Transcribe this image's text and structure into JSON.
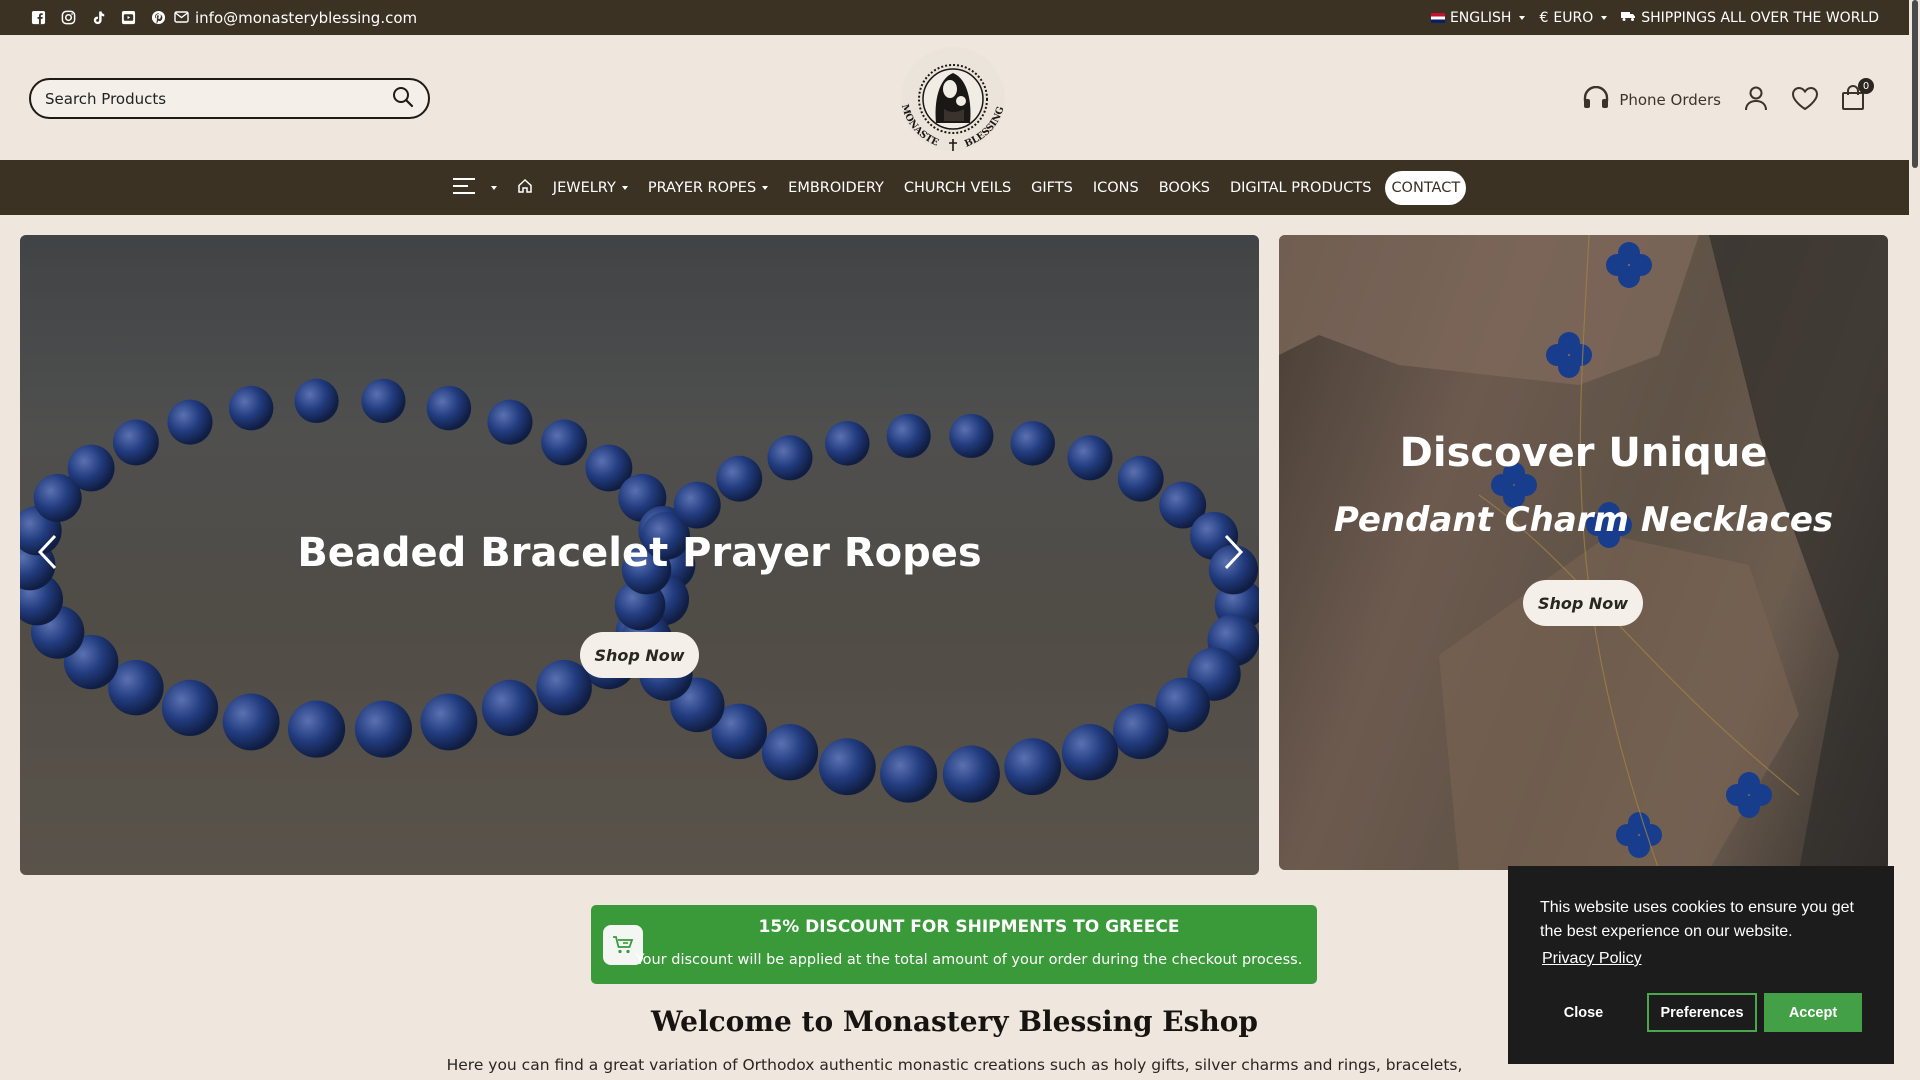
{
  "topbar": {
    "social_icons": [
      "facebook-icon",
      "instagram-icon",
      "tiktok-icon",
      "youtube-icon",
      "pinterest-icon"
    ],
    "email": "info@monasteryblessing.com",
    "language": "ENGLISH",
    "currency": "EURO",
    "currency_symbol": "€",
    "shipping_text": "SHIPPINGS ALL OVER THE WORLD"
  },
  "header": {
    "search_placeholder": "Search Products",
    "logo_text": "MONASTERY BLESSING",
    "phone_orders": "Phone Orders",
    "cart_count": "0"
  },
  "nav": {
    "items": [
      {
        "label": "JEWELRY",
        "dropdown": true
      },
      {
        "label": "PRAYER ROPES",
        "dropdown": true
      },
      {
        "label": "EMBROIDERY"
      },
      {
        "label": "CHURCH VEILS"
      },
      {
        "label": "GIFTS"
      },
      {
        "label": "ICONS"
      },
      {
        "label": "BOOKS"
      },
      {
        "label": "DIGITAL PRODUCTS"
      },
      {
        "label": "CONTACT",
        "active": true
      }
    ]
  },
  "hero": {
    "main_title": "Beaded Bracelet Prayer Ropes",
    "main_button": "Shop Now",
    "side_title": "Discover Unique",
    "side_subtitle": "Pendant Charm Necklaces",
    "side_button": "Shop Now"
  },
  "discount": {
    "title": "15% DISCOUNT FOR SHIPMENTS TO GREECE",
    "text": "Your discount will be applied at the total amount of your order during the checkout process."
  },
  "welcome": {
    "title": "Welcome to Monastery Blessing Eshop",
    "intro": "Here you can find a great variation of Orthodox authentic monastic creations such as holy gifts, silver charms and rings, bracelets,"
  },
  "cookie": {
    "message": "This website uses cookies to ensure you get the best experience on our website.",
    "policy_link": "Privacy Policy",
    "close": "Close",
    "preferences": "Preferences",
    "accept": "Accept"
  },
  "colors": {
    "topbar_bg": "#3c3224",
    "page_bg": "#efe7de",
    "discount_green": "#3a9a3a",
    "accept_green": "#43a047",
    "cookie_bg": "#1c1c1c"
  }
}
